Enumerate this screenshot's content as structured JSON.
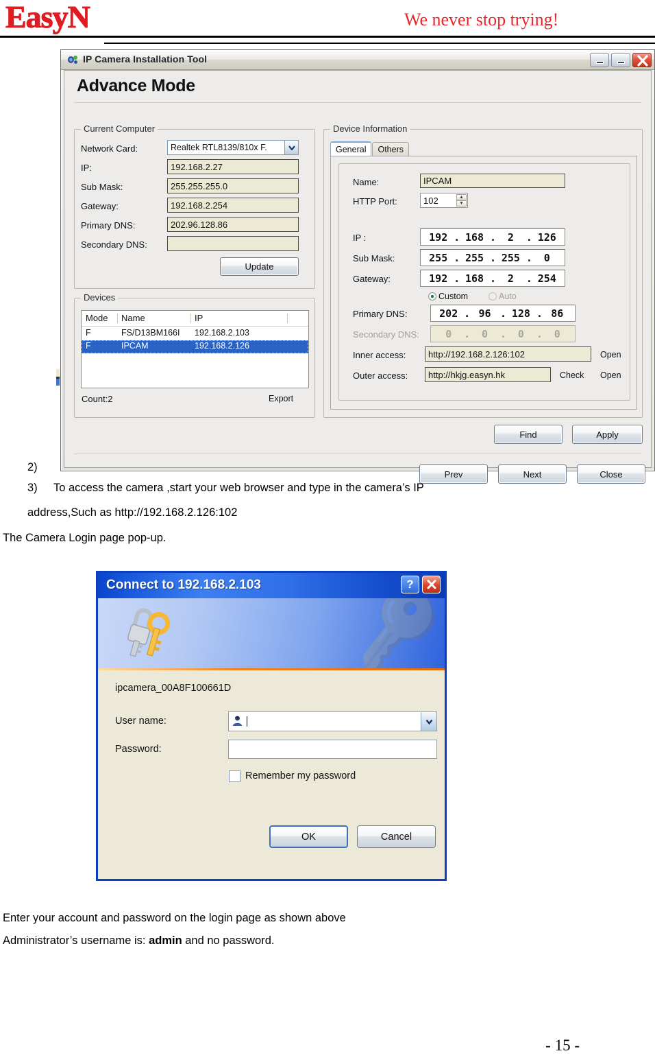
{
  "header": {
    "brand": "EasyN",
    "tagline": "We never stop trying!"
  },
  "app_window": {
    "title": "IP Camera Installation Tool",
    "icon": "camera-icon",
    "heading": "Advance Mode",
    "titlebar_buttons": [
      {
        "name": "minimize",
        "glyph": "_"
      },
      {
        "name": "maximize",
        "glyph": "_"
      },
      {
        "name": "close",
        "glyph": "✕"
      }
    ],
    "current_computer": {
      "group_label": "Current Computer",
      "fields": [
        {
          "label": "Network Card:",
          "value": "Realtek RTL8139/810x F.",
          "type": "combobox"
        },
        {
          "label": "IP:",
          "value": "192.168.2.27",
          "type": "textbox"
        },
        {
          "label": "Sub Mask:",
          "value": "255.255.255.0",
          "type": "textbox"
        },
        {
          "label": "Gateway:",
          "value": "192.168.2.254",
          "type": "textbox"
        },
        {
          "label": "Primary DNS:",
          "value": "202.96.128.86",
          "type": "textbox"
        },
        {
          "label": "Secondary DNS:",
          "value": "",
          "type": "textbox"
        }
      ],
      "update_button": "Update"
    },
    "devices": {
      "group_label": "Devices",
      "columns": [
        "Mode",
        "Name",
        "IP"
      ],
      "rows": [
        {
          "mode": "F",
          "name": "FS/D13BM166I",
          "ip": "192.168.2.103",
          "selected": false
        },
        {
          "mode": "F",
          "name": "IPCAM",
          "ip": "192.168.2.126",
          "selected": true
        }
      ],
      "count_label": "Count:2",
      "export_label": "Export"
    },
    "device_information": {
      "group_label": "Device Information",
      "tabs": [
        {
          "label": "General",
          "active": true
        },
        {
          "label": "Others",
          "active": false
        }
      ],
      "name_label": "Name:",
      "name_value": "IPCAM",
      "http_port_label": "HTTP Port:",
      "http_port_value": "102",
      "ip_label": "IP :",
      "ip_octets": [
        "192",
        "168",
        "2",
        "126"
      ],
      "sub_mask_label": "Sub Mask:",
      "sub_mask_octets": [
        "255",
        "255",
        "255",
        "0"
      ],
      "gateway_label": "Gateway:",
      "gateway_octets": [
        "192",
        "168",
        "2",
        "254"
      ],
      "dns_mode": [
        {
          "label": "Custom",
          "selected": true,
          "enabled": true
        },
        {
          "label": "Auto",
          "selected": false,
          "enabled": false
        }
      ],
      "primary_dns_label": "Primary DNS:",
      "primary_dns_octets": [
        "202",
        "96",
        "128",
        "86"
      ],
      "secondary_dns_label": "Secondary DNS:",
      "secondary_dns_octets": [
        "0",
        "0",
        "0",
        "0"
      ],
      "inner_access_label": "Inner access:",
      "inner_access_value": "http://192.168.2.126:102",
      "inner_access_open": "Open",
      "outer_access_label": "Outer access:",
      "outer_access_value": "http://hkjg.easyn.hk",
      "outer_access_check": "Check",
      "outer_access_open": "Open"
    },
    "action_buttons": {
      "find": "Find",
      "apply": "Apply"
    },
    "nav_buttons": {
      "prev": "Prev",
      "next": "Next",
      "close": "Close"
    }
  },
  "login_window": {
    "title": "Connect to 192.168.2.103",
    "help_glyph": "?",
    "close_glyph": "✕",
    "banner_icon": "keys-icon",
    "realm": "ipcamera_00A8F100661D",
    "username_label": "User name:",
    "username_value": "",
    "username_icon": "user-icon",
    "password_label": "Password:",
    "password_value": "",
    "remember_label": "Remember my password",
    "remember_checked": false,
    "ok_button": "OK",
    "cancel_button": "Cancel"
  },
  "document": {
    "step2_marker": "2)",
    "step3_marker": "3)",
    "step3_line1": "To access the camera ,start your web browser and type in the camera’s IP",
    "step3_line2": "address,Such as http://192.168.2.126:102",
    "popup_line": "The Camera Login page pop-up.",
    "footer_line1": "Enter your account and password on the login page as shown above",
    "footer_line2_pre": "Administrator’s username is: ",
    "footer_line2_bold": "admin",
    "footer_line2_post": " and no password.",
    "page_number": "- 15 -"
  }
}
